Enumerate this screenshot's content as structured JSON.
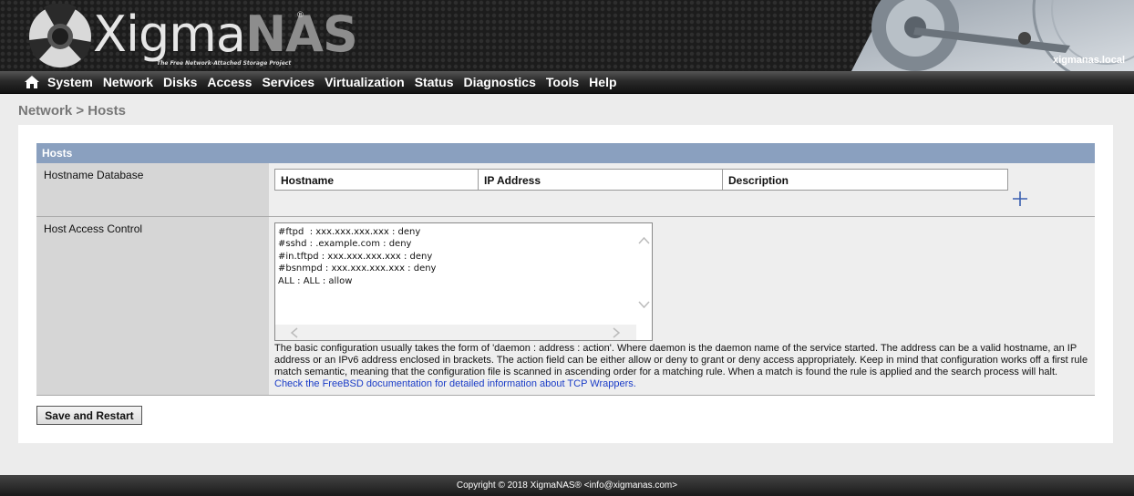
{
  "header": {
    "logo_main": "Xigma",
    "logo_accent": "NAS",
    "logo_reg": "®",
    "logo_tagline": "The Free Network-Attached Storage Project",
    "hostname": "xigmanas.local"
  },
  "nav": {
    "home_icon": "home-icon",
    "items": [
      "System",
      "Network",
      "Disks",
      "Access",
      "Services",
      "Virtualization",
      "Status",
      "Diagnostics",
      "Tools",
      "Help"
    ]
  },
  "page": {
    "title": "Network > Hosts"
  },
  "section": {
    "title": "Hosts"
  },
  "hostname_db": {
    "label": "Hostname Database",
    "columns": [
      "Hostname",
      "IP Address",
      "Description"
    ],
    "add_icon": "plus-icon"
  },
  "host_access": {
    "label": "Host Access Control",
    "textarea_value": "#ftpd  : xxx.xxx.xxx.xxx : deny\n#sshd : .example.com : deny\n#in.tftpd : xxx.xxx.xxx.xxx : deny\n#bsnmpd : xxx.xxx.xxx.xxx : deny\nALL : ALL : allow",
    "help_text": "The basic configuration usually takes the form of 'daemon : address : action'. Where daemon is the daemon name of the service started. The address can be a valid hostname, an IP address or an IPv6 address enclosed in brackets. The action field can be either allow or deny to grant or deny access appropriately. Keep in mind that configuration works off a first rule match semantic, meaning that the configuration file is scanned in ascending order for a matching rule. When a match is found the rule is applied and the search process will halt.",
    "help_link": "Check the FreeBSD documentation for detailed information about TCP Wrappers."
  },
  "actions": {
    "save_label": "Save and Restart"
  },
  "footer": {
    "copyright": "Copyright © 2018 XigmaNAS® <info@xigmanas.com>"
  },
  "colors": {
    "section_header": "#8aa0bf",
    "label_bg": "#d6d6d6",
    "link": "#1a3cc7"
  }
}
